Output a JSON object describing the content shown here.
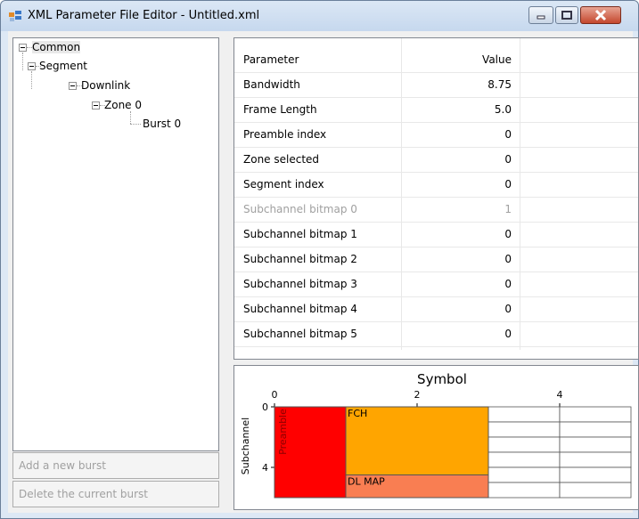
{
  "window": {
    "title": "XML Parameter File Editor - Untitled.xml",
    "icon": "app-icon"
  },
  "tree": {
    "nodes": [
      {
        "label": "Common",
        "level": 0,
        "expanded": true,
        "selected": true
      },
      {
        "label": "Segment",
        "level": 1,
        "expanded": true
      },
      {
        "label": "Downlink",
        "level": 2,
        "expanded": true
      },
      {
        "label": "Zone 0",
        "level": 3,
        "expanded": true
      },
      {
        "label": "Burst 0",
        "level": 4,
        "leaf": true
      }
    ]
  },
  "buttons": {
    "add_burst": "Add a new burst",
    "delete_burst": "Delete the current burst"
  },
  "grid": {
    "header": {
      "parameter": "Parameter",
      "value": "Value"
    },
    "rows": [
      {
        "name": "Bandwidth",
        "value": "8.75"
      },
      {
        "name": "Frame Length",
        "value": "5.0"
      },
      {
        "name": "Preamble index",
        "value": "0"
      },
      {
        "name": "Zone selected",
        "value": "0"
      },
      {
        "name": "Segment index",
        "value": "0"
      },
      {
        "name": "Subchannel bitmap 0",
        "value": "1",
        "disabled": true
      },
      {
        "name": "Subchannel bitmap 1",
        "value": "0"
      },
      {
        "name": "Subchannel bitmap 2",
        "value": "0"
      },
      {
        "name": "Subchannel bitmap 3",
        "value": "0"
      },
      {
        "name": "Subchannel bitmap 4",
        "value": "0"
      },
      {
        "name": "Subchannel bitmap 5",
        "value": "0"
      }
    ]
  },
  "chart_data": {
    "type": "frame-map",
    "title": "Symbol",
    "xlabel": "Symbol",
    "ylabel": "Subchannel",
    "xticks": [
      "0",
      "2",
      "4"
    ],
    "yticks": [
      "0",
      "4"
    ],
    "xlim": [
      0,
      5
    ],
    "ylim": [
      0,
      6
    ],
    "regions": [
      {
        "label": "Preamble",
        "x0": 0,
        "x1": 1,
        "y0": 0,
        "y1": 6,
        "color": "#ff0000",
        "vertical_label": true
      },
      {
        "label": "FCH",
        "x0": 1,
        "x1": 3,
        "y0": 0,
        "y1": 4.5,
        "color": "#ffa500"
      },
      {
        "label": "DL MAP",
        "x0": 1,
        "x1": 3,
        "y0": 4.5,
        "y1": 6,
        "color": "#f97e52"
      }
    ],
    "colors": {
      "preamble": "#ff0000",
      "fch": "#ffa500",
      "dlmap": "#f97e52"
    }
  }
}
